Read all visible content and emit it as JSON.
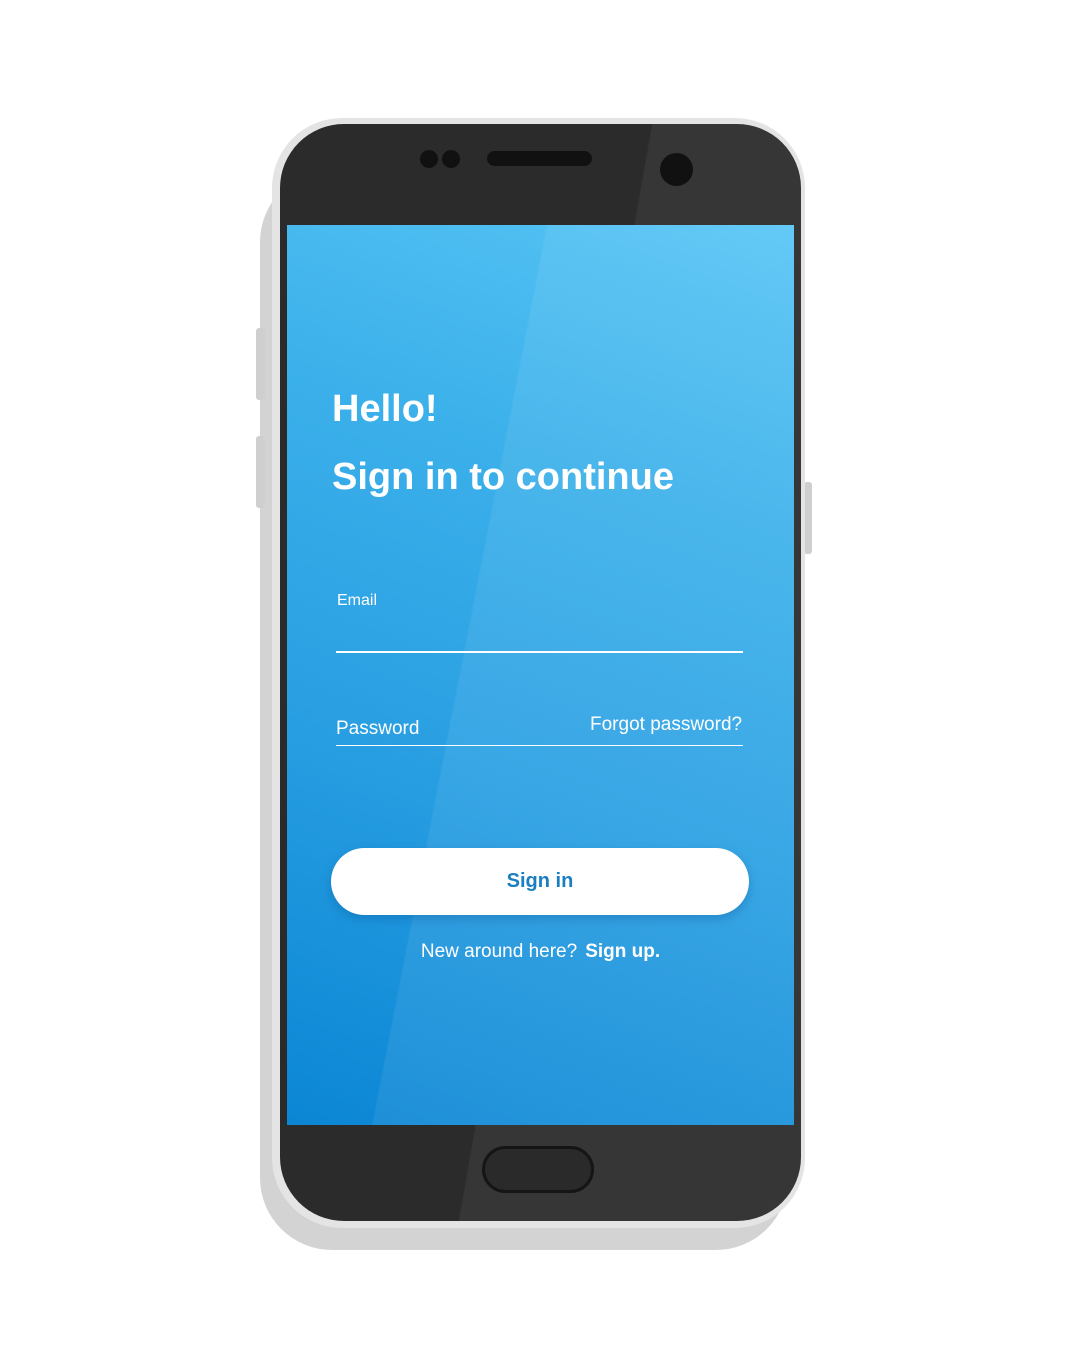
{
  "screen": {
    "greeting": "Hello!",
    "headline": "Sign in to continue",
    "email": {
      "label": "Email",
      "value": ""
    },
    "password": {
      "placeholder": "Password",
      "value": ""
    },
    "forgot_password_label": "Forgot password?",
    "sign_in_label": "Sign in",
    "signup_prompt": "New around here?",
    "signup_link_label": "Sign up."
  },
  "colors": {
    "gradient_top": "#58c5f5",
    "gradient_bottom": "#0b86d4",
    "button_text": "#1a7fc0",
    "phone_body": "#2b2b2b"
  },
  "icons": {
    "home_button": "home-button-icon",
    "front_camera": "front-camera-icon",
    "speaker": "speaker-grille-icon",
    "sensors": "sensor-dots-icon"
  }
}
